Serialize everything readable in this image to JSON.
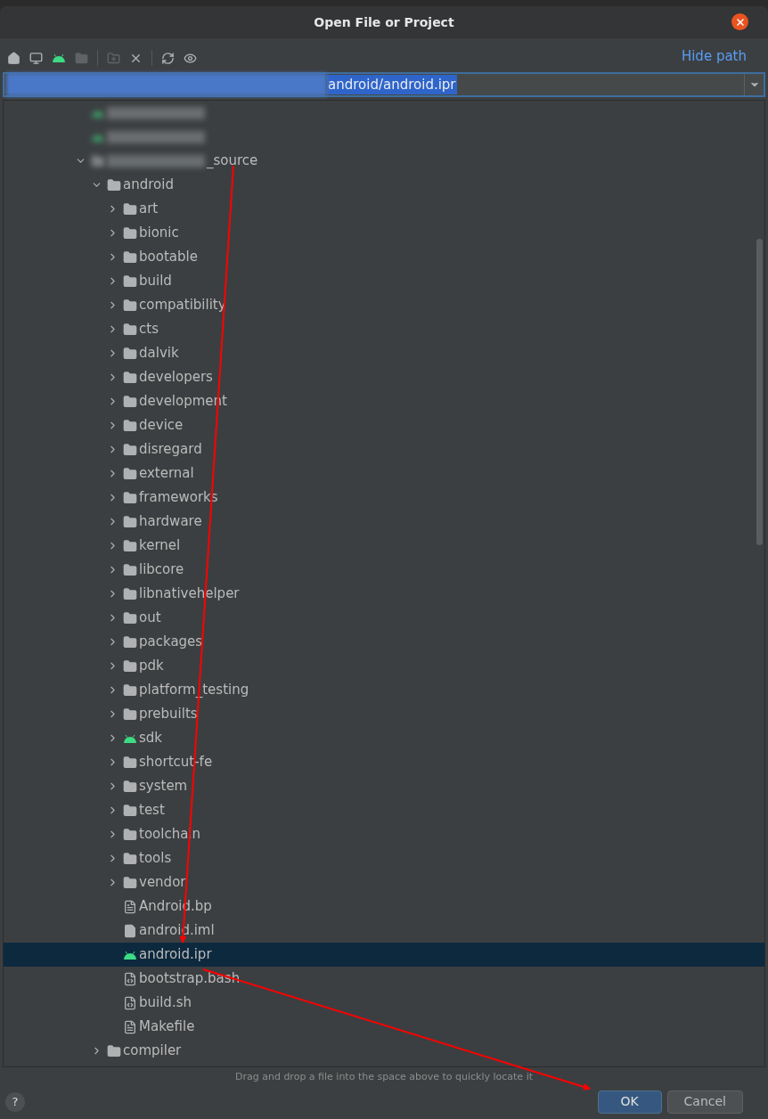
{
  "dialog": {
    "title": "Open File or Project"
  },
  "toolbar": [
    {
      "kind": "home",
      "disabled": false
    },
    {
      "kind": "desktop",
      "disabled": false
    },
    {
      "kind": "android",
      "disabled": false
    },
    {
      "kind": "folder",
      "disabled": true
    },
    {
      "kind": "new-folder",
      "disabled": true
    },
    {
      "kind": "delete",
      "disabled": false
    },
    {
      "kind": "refresh",
      "disabled": false
    },
    {
      "kind": "show-hidden",
      "disabled": false
    }
  ],
  "hide_path": "Hide path",
  "path_field": {
    "value": "android/android.ipr"
  },
  "tree": [
    {
      "kind": "android",
      "blurred": true
    },
    {
      "kind": "android",
      "blurred": true
    },
    {
      "kind": "folder",
      "name": "_source",
      "blurred": true,
      "expanded": true,
      "children": [
        {
          "kind": "folder",
          "name": "android",
          "expanded": true,
          "children": [
            {
              "kind": "folder",
              "name": "art",
              "expanded": false
            },
            {
              "kind": "folder",
              "name": "bionic",
              "expanded": false
            },
            {
              "kind": "folder",
              "name": "bootable",
              "expanded": false
            },
            {
              "kind": "folder",
              "name": "build",
              "expanded": false
            },
            {
              "kind": "folder",
              "name": "compatibility",
              "expanded": false
            },
            {
              "kind": "folder",
              "name": "cts",
              "expanded": false
            },
            {
              "kind": "folder",
              "name": "dalvik",
              "expanded": false
            },
            {
              "kind": "folder",
              "name": "developers",
              "expanded": false
            },
            {
              "kind": "folder",
              "name": "development",
              "expanded": false
            },
            {
              "kind": "folder",
              "name": "device",
              "expanded": false
            },
            {
              "kind": "folder",
              "name": "disregard",
              "expanded": false
            },
            {
              "kind": "folder",
              "name": "external",
              "expanded": false
            },
            {
              "kind": "folder",
              "name": "frameworks",
              "expanded": false
            },
            {
              "kind": "folder",
              "name": "hardware",
              "expanded": false
            },
            {
              "kind": "folder",
              "name": "kernel",
              "expanded": false
            },
            {
              "kind": "folder",
              "name": "libcore",
              "expanded": false
            },
            {
              "kind": "folder",
              "name": "libnativehelper",
              "expanded": false
            },
            {
              "kind": "folder",
              "name": "out",
              "expanded": false
            },
            {
              "kind": "folder",
              "name": "packages",
              "expanded": false
            },
            {
              "kind": "folder",
              "name": "pdk",
              "expanded": false
            },
            {
              "kind": "folder",
              "name": "platform_testing",
              "expanded": false
            },
            {
              "kind": "folder",
              "name": "prebuilts",
              "expanded": false
            },
            {
              "kind": "android",
              "name": "sdk",
              "expanded": false
            },
            {
              "kind": "folder",
              "name": "shortcut-fe",
              "expanded": false
            },
            {
              "kind": "folder",
              "name": "system",
              "expanded": false
            },
            {
              "kind": "folder",
              "name": "test",
              "expanded": false
            },
            {
              "kind": "folder",
              "name": "toolchain",
              "expanded": false
            },
            {
              "kind": "folder",
              "name": "tools",
              "expanded": false
            },
            {
              "kind": "folder",
              "name": "vendor",
              "expanded": false
            },
            {
              "kind": "text-file",
              "name": "Android.bp",
              "selected": false
            },
            {
              "kind": "module-file",
              "name": "android.iml",
              "selected": false
            },
            {
              "kind": "android-file",
              "name": "android.ipr",
              "selected": true
            },
            {
              "kind": "script-file",
              "name": "bootstrap.bash",
              "selected": false
            },
            {
              "kind": "script-file",
              "name": "build.sh",
              "selected": false
            },
            {
              "kind": "text-file",
              "name": "Makefile",
              "selected": false
            }
          ]
        },
        {
          "kind": "folder",
          "name": "compiler",
          "expanded": false
        }
      ]
    }
  ],
  "hint": "Drag and drop a file into the space above to quickly locate it",
  "help_button": "?",
  "buttons": [
    {
      "label": "OK",
      "kind": "primary"
    },
    {
      "label": "Cancel",
      "kind": "secondary"
    }
  ]
}
